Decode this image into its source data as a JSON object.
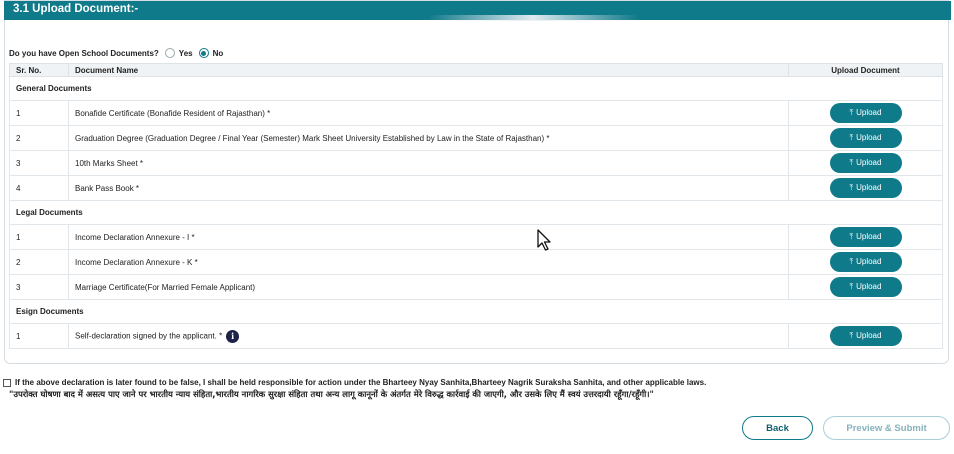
{
  "panel": {
    "title": "3.1 Upload Document:-"
  },
  "question": {
    "label": "Do you have Open School Documents?",
    "options": [
      "Yes",
      "No"
    ],
    "selected": "No"
  },
  "table": {
    "headers": {
      "sr_no": "Sr. No.",
      "doc_name": "Document Name",
      "upload": "Upload Document"
    },
    "upload_label": "Upload",
    "sections": [
      {
        "title": "General Documents",
        "rows": [
          {
            "sr": "1",
            "name": "Bonafide Certificate (Bonafide Resident of Rajasthan) *"
          },
          {
            "sr": "2",
            "name": "Graduation Degree (Graduation Degree / Final Year (Semester) Mark Sheet University Established by Law in the State of Rajasthan) *"
          },
          {
            "sr": "3",
            "name": "10th Marks Sheet *"
          },
          {
            "sr": "4",
            "name": "Bank Pass Book *"
          }
        ]
      },
      {
        "title": "Legal Documents",
        "rows": [
          {
            "sr": "1",
            "name": "Income Declaration Annexure - I *"
          },
          {
            "sr": "2",
            "name": "Income Declaration Annexure - K *"
          },
          {
            "sr": "3",
            "name": "Marriage Certificate(For Married Female Applicant)"
          }
        ]
      },
      {
        "title": "Esign Documents",
        "rows": [
          {
            "sr": "1",
            "name": "Self-declaration signed by the applicant. *",
            "info": "i"
          }
        ]
      }
    ]
  },
  "declaration": {
    "english": "If the above declaration is later found to be false, I shall be held responsible for action under the Bharteey Nyay Sanhita,Bharteey Nagrik Suraksha Sanhita, and other applicable laws.",
    "hindi": "\"उपरोक्त घोषणा बाद में असत्य पाए जाने पर भारतीय न्याय संहिता,भारतीय नागरिक सुरक्षा संहिता तथा अन्य लागू कानूनों के अंतर्गत मेरे विरुद्ध कार्रवाई की जाएगी, और उसके लिए मैं स्वयं उत्तरदायी रहूँगा/रहूँगी।\""
  },
  "footer": {
    "back_label": "Back",
    "submit_label": "Preview & Submit"
  },
  "colors": {
    "primary": "#0f7a8a",
    "info_icon": "#1d2348"
  },
  "icons": {
    "upload": "upload-arrow-icon",
    "info": "info-icon",
    "cursor": "mouse-pointer-icon"
  }
}
